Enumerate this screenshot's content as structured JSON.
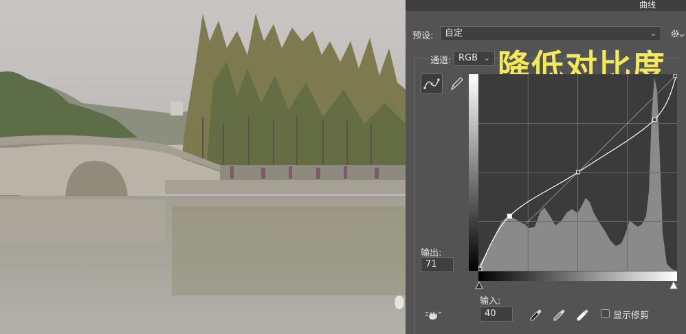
{
  "dialog": {
    "title": "曲线",
    "preset_label": "预设:",
    "preset_value": "自定",
    "channel_label": "通道:",
    "channel_value": "RGB",
    "output_label": "输出:",
    "output_value": "71",
    "input_label": "输入:",
    "input_value": "40",
    "show_clipping_label": "显示修剪",
    "show_clipping_checked": false
  },
  "annotation_text": "降低对比度",
  "icons": {
    "gear": "gear-icon",
    "curve_tool": "curve-point-tool-icon",
    "pencil_tool": "pencil-icon",
    "hand_tool": "target-adjust-hand-icon",
    "black_point": "black-eyedropper-icon",
    "gray_point": "gray-eyedropper-icon",
    "white_point": "white-eyedropper-icon",
    "chevron": "chevron-down-icon"
  },
  "colors": {
    "annotation": "#f3e95c",
    "dialog_bg": "#535353",
    "graph_bg": "#3b3b3b",
    "histogram": "#8a8a8a"
  },
  "curve": {
    "points": [
      [
        0,
        0
      ],
      [
        40,
        71
      ],
      [
        128,
        128
      ],
      [
        226,
        196
      ],
      [
        255,
        255
      ]
    ]
  }
}
